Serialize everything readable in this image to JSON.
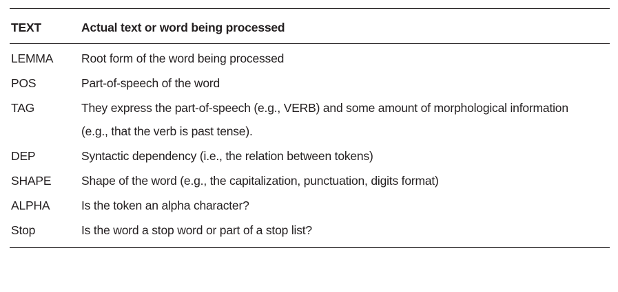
{
  "table": {
    "header": {
      "key": "TEXT",
      "desc": "Actual text or word being processed"
    },
    "rows": [
      {
        "key": "LEMMA",
        "desc": "Root form of the word being processed"
      },
      {
        "key": "POS",
        "desc": "Part-of-speech of the word"
      },
      {
        "key": "TAG",
        "desc": "They express the part-of-speech (e.g., VERB) and some amount of morphological information (e.g., that the verb is past tense)."
      },
      {
        "key": "DEP",
        "desc": "Syntactic dependency (i.e., the relation between tokens)"
      },
      {
        "key": "SHAPE",
        "desc": "Shape of the word (e.g., the capitalization, punctuation, digits format)"
      },
      {
        "key": "ALPHA",
        "desc": "Is the token an alpha character?"
      },
      {
        "key": "Stop",
        "desc": "Is the word a stop word or part of a stop list?"
      }
    ]
  }
}
